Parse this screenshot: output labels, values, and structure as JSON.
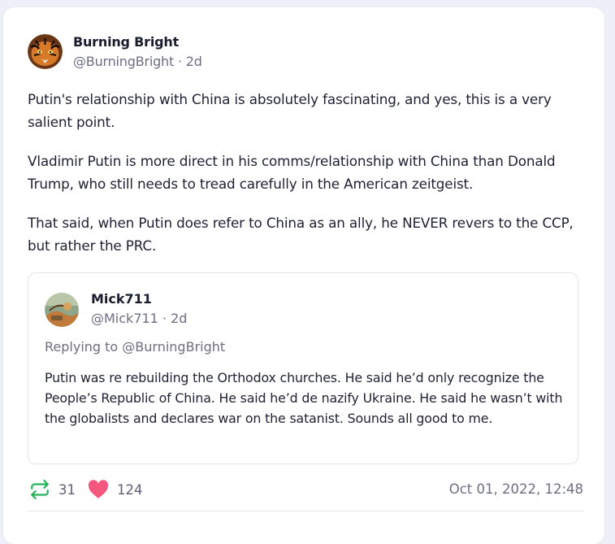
{
  "post": {
    "author": {
      "name": "Burning Bright",
      "handle": "@BurningBright",
      "age": "2d"
    },
    "paragraphs": [
      "Putin's relationship with China is absolutely fascinating, and yes, this is a very salient point.",
      "Vladimir Putin is more direct in his comms/relationship with China than Donald Trump, who still needs to tread carefully in the American zeitgeist.",
      "That said, when Putin does refer to China as an ally, he NEVER revers to the CCP, but rather the PRC."
    ]
  },
  "quote": {
    "author": {
      "name": "Mick711",
      "handle": "@Mick711",
      "age": "2d"
    },
    "replying_to": "Replying to @BurningBright",
    "text": "Putin was re rebuilding the Orthodox churches. He said he’d only recognize the People’s Republic of China. He said he’d de nazify Ukraine. He said he wasn’t with the globalists and declares war on the satanist. Sounds all good to me."
  },
  "actions": {
    "retweets": "31",
    "likes": "124",
    "timestamp": "Oct 01, 2022, 12:48"
  },
  "colors": {
    "retweet_icon": "#23b45a",
    "like_icon": "#f4577e",
    "muted_text": "#6c6f82",
    "background": "#eef0f9"
  },
  "icons": {
    "retweet": "retweet-icon",
    "like": "heart-icon"
  }
}
